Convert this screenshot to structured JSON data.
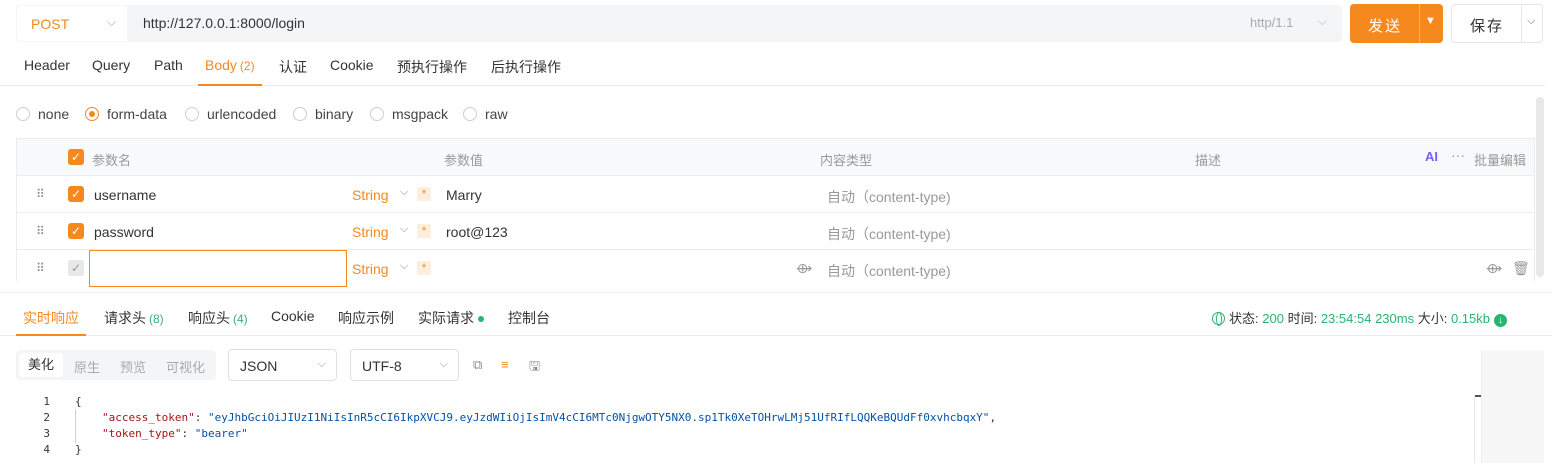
{
  "request": {
    "method": "POST",
    "url": "http://127.0.0.1:8000/login",
    "protocol": "http/1.1",
    "send_label": "发送",
    "save_label": "保存"
  },
  "request_tabs": [
    {
      "label": "Header",
      "count": ""
    },
    {
      "label": "Query",
      "count": ""
    },
    {
      "label": "Path",
      "count": ""
    },
    {
      "label": "Body",
      "count": "(2)"
    },
    {
      "label": "认证",
      "count": ""
    },
    {
      "label": "Cookie",
      "count": ""
    },
    {
      "label": "预执行操作",
      "count": ""
    },
    {
      "label": "后执行操作",
      "count": ""
    }
  ],
  "active_request_tab": "Body",
  "body_types": [
    "none",
    "form-data",
    "urlencoded",
    "binary",
    "msgpack",
    "raw"
  ],
  "selected_body_type": "form-data",
  "params": {
    "headers": {
      "name": "参数名",
      "value": "参数值",
      "content_type": "内容类型",
      "description": "描述",
      "ai": "AI",
      "bulk_edit": "批量编辑"
    },
    "rows": [
      {
        "name": "username",
        "type": "String",
        "required": "*",
        "value": "Marry",
        "content_type": "自动（content-type)",
        "checked": true
      },
      {
        "name": "password",
        "type": "String",
        "required": "*",
        "value": "root@123",
        "content_type": "自动（content-type)",
        "checked": true
      },
      {
        "name": "",
        "type": "String",
        "required": "*",
        "value": "",
        "content_type": "自动（content-type)",
        "checked": false
      }
    ]
  },
  "response_tabs": [
    {
      "label": "实时响应",
      "count": ""
    },
    {
      "label": "请求头",
      "count": "(8)"
    },
    {
      "label": "响应头",
      "count": "(4)"
    },
    {
      "label": "Cookie",
      "count": ""
    },
    {
      "label": "响应示例",
      "count": ""
    },
    {
      "label": "实际请求",
      "count": ""
    },
    {
      "label": "控制台",
      "count": ""
    }
  ],
  "status": {
    "status_label": "状态:",
    "status_code": "200",
    "time_label": "时间:",
    "time": "23:54:54",
    "duration": "230ms",
    "size_label": "大小:",
    "size": "0.15kb"
  },
  "view_modes": [
    "美化",
    "原生",
    "预览",
    "可视化"
  ],
  "active_view_mode": "美化",
  "format": "JSON",
  "encoding": "UTF-8",
  "code": {
    "line_numbers": [
      "1",
      "2",
      "3",
      "4"
    ],
    "open_brace": "{",
    "close_brace": "}",
    "access_token_key": "\"access_token\"",
    "access_token_value": "\"eyJhbGciOiJIUzI1NiIsInR5cCI6IkpXVCJ9.eyJzdWIiOjIsImV4cCI6MTc0NjgwOTY5NX0.sp1Tk0XeTOHrwLMj51UfRIfLQQKeBQUdFf0xvhcbqxY\"",
    "token_type_key": "\"token_type\"",
    "token_type_value": "\"bearer\""
  },
  "colors": {
    "accent": "#f5891e",
    "success": "#29b470"
  }
}
